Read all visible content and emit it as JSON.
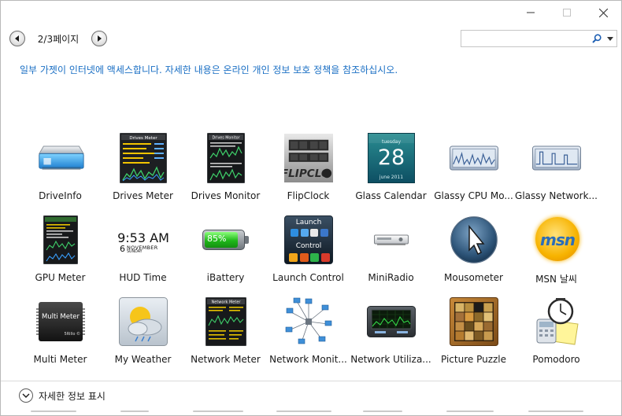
{
  "window": {
    "minimize_icon": "minimize-icon",
    "maximize_icon": "maximize-icon",
    "close_icon": "close-icon"
  },
  "pager": {
    "label": "2/3페이지",
    "prev_icon": "arrow-left-icon",
    "next_icon": "arrow-right-icon"
  },
  "search": {
    "value": "",
    "placeholder": "",
    "icon": "search-icon",
    "dropdown_icon": "dropdown-arrow-icon"
  },
  "notice": "일부 가젯이 인터넷에 액세스합니다. 자세한 내용은 온라인 개인 정보 보호 정책을 참조하십시오.",
  "colors": {
    "notice_text": "#1a6fc4",
    "search_icon": "#1e5fb3"
  },
  "gadgets": [
    [
      {
        "label": "DriveInfo",
        "icon": "drive-info-icon"
      },
      {
        "label": "Drives Meter",
        "icon": "drives-meter-icon"
      },
      {
        "label": "Drives Monitor",
        "icon": "drives-monitor-icon"
      },
      {
        "label": "FlipClock",
        "icon": "flipclock-icon"
      },
      {
        "label": "Glass Calendar",
        "icon": "glass-calendar-icon",
        "day": "28",
        "weekday": "tuesday",
        "month": "june 2011"
      },
      {
        "label": "Glassy CPU Mo...",
        "icon": "glassy-cpu-monitor-icon"
      },
      {
        "label": "Glassy Network...",
        "icon": "glassy-network-icon"
      }
    ],
    [
      {
        "label": "GPU Meter",
        "icon": "gpu-meter-icon"
      },
      {
        "label": "HUD Time",
        "icon": "hud-time-icon",
        "time": "9:53 AM",
        "day": "6",
        "month": "NOVEMBER",
        "weekday": "SUNDAY"
      },
      {
        "label": "iBattery",
        "icon": "battery-icon",
        "percent": "85%"
      },
      {
        "label": "Launch Control",
        "icon": "launch-control-icon",
        "top": "Launch",
        "mid": "Control"
      },
      {
        "label": "MiniRadio",
        "icon": "radio-icon"
      },
      {
        "label": "Mousometer",
        "icon": "mouse-pointer-icon"
      },
      {
        "label": "MSN 날씨",
        "icon": "msn-weather-icon",
        "logo": "msn"
      }
    ],
    [
      {
        "label": "Multi Meter",
        "icon": "multi-meter-icon",
        "line1": "Multi Meter",
        "line2": "5Rillo ©"
      },
      {
        "label": "My Weather",
        "icon": "weather-icon"
      },
      {
        "label": "Network Meter",
        "icon": "network-meter-icon",
        "title": "Network Meter"
      },
      {
        "label": "Network Monit...",
        "icon": "network-monitor-icon"
      },
      {
        "label": "Network Utiliza...",
        "icon": "network-utilization-icon"
      },
      {
        "label": "Picture Puzzle",
        "icon": "picture-puzzle-icon"
      },
      {
        "label": "Pomodoro",
        "icon": "pomodoro-icon"
      }
    ]
  ],
  "details": {
    "label": "자세한 정보 표시",
    "icon": "chevron-down-icon"
  }
}
